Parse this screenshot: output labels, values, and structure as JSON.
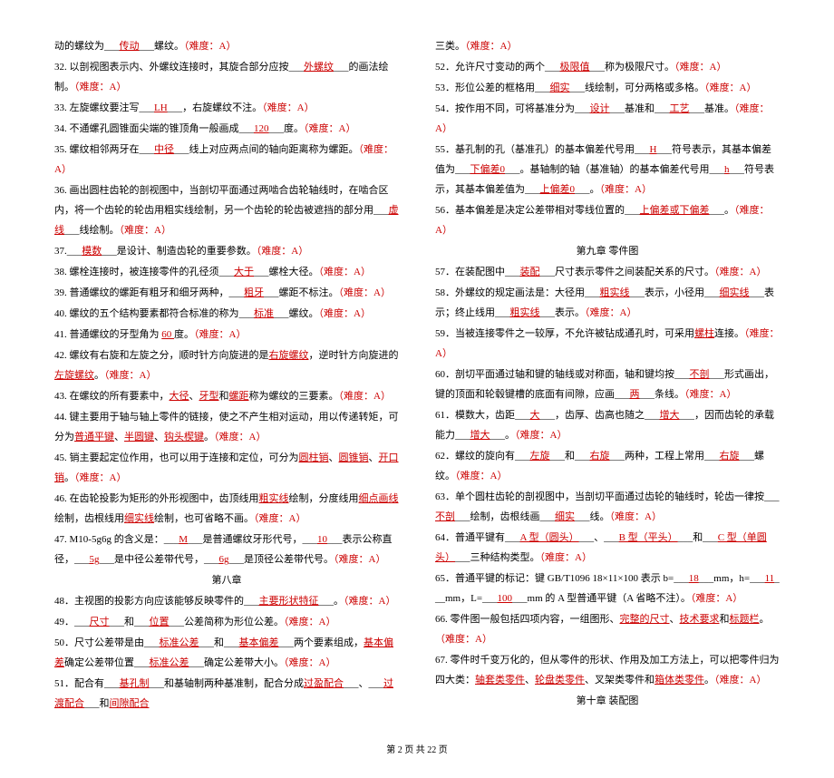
{
  "left": {
    "l31": {
      "pre": "动的螺纹为___",
      "a1": "传动",
      "post": "___螺纹。",
      "diff": "（难度：A）"
    },
    "l32": {
      "pre": "32. 以剖视图表示内、外螺纹连接时，其旋合部分应按___",
      "a1": "外螺纹",
      "post": "___的画法绘制。",
      "diff": "（难度：A）"
    },
    "l33": {
      "pre": "33. 左旋螺纹要注写___",
      "a1": "LH",
      "post": "___，右旋螺纹不注。",
      "diff": "（难度：A）"
    },
    "l34": {
      "pre": "34. 不通螺孔圆锥面尖端的锥顶角一般画成___",
      "a1": "120",
      "post": "___度。",
      "diff": "（难度：A）"
    },
    "l35": {
      "pre": "35. 螺纹相邻两牙在___",
      "a1": "中径",
      "post": "___线上对应两点间的轴向距离称为螺距。",
      "diff": "（难度：A）"
    },
    "l36": {
      "pre": "36. 画出圆柱齿轮的剖视图中，当剖切平面通过两啮合齿轮轴线时，在啮合区内，将一个齿轮的轮齿用粗实线绘制，另一个齿轮的轮齿被遮挡的部分用___",
      "a1": "虚线",
      "post": "___线绘制。",
      "diff": "（难度：A）"
    },
    "l37": {
      "pre": "37.___",
      "a1": "模数",
      "post": "___是设计、制造齿轮的重要参数。",
      "diff": "（难度：A）"
    },
    "l38": {
      "pre": "38. 螺栓连接时，被连接零件的孔径须___",
      "a1": "大于",
      "post": "___螺栓大径。",
      "diff": "（难度：A）"
    },
    "l39": {
      "pre": "39. 普通螺纹的螺距有粗牙和细牙两种，___",
      "a1": "粗牙",
      "post": "___螺距不标注。",
      "diff": "（难度：A）"
    },
    "l40": {
      "pre": "40. 螺纹的五个结构要素都符合标准的称为___",
      "a1": "标准",
      "post": "___螺纹。",
      "diff": "（难度：A）"
    },
    "l41": {
      "pre": "41. 普通螺纹的牙型角为 ",
      "a1": "60 ",
      "post": "度。",
      "diff": "（难度：A）"
    },
    "l42": {
      "pre": "42. 螺纹有右旋和左旋之分，顺时针方向旋进的是",
      "a1": "右旋螺纹",
      "mid": "，逆时针方向旋进的",
      "a2": "左旋螺纹",
      "post": "。",
      "diff": "（难度：A）"
    },
    "l43": {
      "pre": "43. 在螺纹的所有要素中，",
      "a1": "大径",
      "c1": "、",
      "a2": "牙型",
      "c2": "和",
      "a3": "螺距",
      "post": "称为螺纹的三要素。",
      "diff": "（难度：A）"
    },
    "l44": {
      "pre": "44. 键主要用于轴与轴上零件的链接，使之不产生相对运动，用以传递转矩，可分为",
      "a1": "普通平键",
      "c1": "、",
      "a2": "半圆键",
      "c2": "、",
      "a3": "钩头楔键",
      "post": "。",
      "diff": "（难度：A）"
    },
    "l45": {
      "pre": "45. 销主要起定位作用，也可以用于连接和定位，可分为",
      "a1": "圆柱销",
      "c1": "、",
      "a2": "圆锥销",
      "c2": "、",
      "a3": "开口销",
      "post": "。",
      "diff": "（难度：A）"
    },
    "l46": {
      "pre": "46. 在齿轮投影为矩形的外形视图中，齿顶线用",
      "a1": "粗实线",
      "mid1": "绘制，分度线用",
      "a2": "细点画线",
      "mid2": "绘制，齿根线用",
      "a3": "细实线",
      "post": "绘制，也可省略不画。",
      "diff": "（难度：A）"
    },
    "l47": {
      "pre": "47. M10-5g6g 的含义是：___",
      "a1": "M",
      "mid1": "___是普通螺纹牙形代号，___",
      "a2": "10",
      "mid2": "___表示公称直径，___",
      "a3": "5g",
      "post": "___是中径公差带代号，___",
      "a4": "6g",
      "post2": "___是顶径公差带代号。",
      "diff": "（难度：A）"
    },
    "s8": "第八章",
    "l48": {
      "pre": "48．主视图的投影方向应该能够反映零件的___",
      "a1": "主要形状特征",
      "post": "___。",
      "diff": "（难度：A）"
    },
    "l49": {
      "pre": "49．___",
      "a1": "尺寸",
      "mid": "___和___",
      "a2": "位置",
      "post": "___公差简称为形位公差。",
      "diff": "（难度：A）"
    },
    "l50": {
      "pre": "50．尺寸公差带是由___",
      "a1": "标准公差",
      "mid": "___和___",
      "a2": "基本偏差",
      "mid2": "___两个要素组成，",
      "a3": "基本偏差",
      "mid3": "确定公差带位置___",
      "a4": "标准公差",
      "post": "___确定公差带大小。",
      "diff": "（难度：A）"
    },
    "l51": {
      "pre": "51．配合有___",
      "a1": "基孔制",
      "mid": "___和基轴制两种基准制，配合分成",
      "a2": "过盈配合",
      "c1": "___、___",
      "a3": "过渡配合",
      "c2": "___和",
      "a4": "间隙配合"
    }
  },
  "right": {
    "l51b": {
      "pre": "三类。",
      "diff": "（难度：A）"
    },
    "l52": {
      "pre": "52．允许尺寸变动的两个___",
      "a1": "极限值",
      "post": "___称为极限尺寸。",
      "diff": "（难度：A）"
    },
    "l53": {
      "pre": "53．形位公差的框格用___",
      "a1": "细实",
      "post": "___线绘制，可分两格或多格。",
      "diff": "（难度：A）"
    },
    "l54": {
      "pre": "54．按作用不同，可将基准分为___",
      "a1": "设计",
      "mid": "___基准和___",
      "a2": "工艺",
      "post": "___基准。",
      "diff": "（难度：A）"
    },
    "l55": {
      "pre": "55．基孔制的孔（基准孔）的基本偏差代号用___",
      "a1": "H",
      "mid": "___符号表示，其基本偏差值为___",
      "a2": "下偏差0",
      "post": "___。基轴制的轴（基准轴）的基本偏差代号用___",
      "a3": "h",
      "mid2": "___符号表示，其基本偏差值为___",
      "a4": "上偏差0",
      "post2": "___。",
      "diff": "（难度：A）"
    },
    "l56": {
      "pre": "56．基本偏差是决定公差带相对零线位置的___",
      "a1": "上偏差或下偏差",
      "post": "___。",
      "diff": "（难度：A）"
    },
    "s9": "第九章 零件图",
    "l57": {
      "pre": "57．在装配图中___",
      "a1": "装配",
      "post": "___尺寸表示零件之间装配关系的尺寸。",
      "diff": "（难度：A）"
    },
    "l58": {
      "pre": "58．外螺纹的规定画法是：大径用___",
      "a1": "粗实线",
      "mid": "___表示，小径用___",
      "a2": "细实线",
      "mid2": "___表示；终止线用___",
      "a3": "粗实线",
      "post": "___表示。",
      "diff": "（难度：A）"
    },
    "l59": {
      "pre": "59．当被连接零件之一较厚，不允许被钻成通孔时，可采用",
      "a1": "螺柱",
      "post": "连接。",
      "diff": "（难度：A）"
    },
    "l60": {
      "pre": "60．剖切平面通过轴和键的轴线或对称面，轴和键均按___",
      "a1": "不剖",
      "post": "___形式画出，键的顶面和轮毂键槽的底面有间隙，应画___",
      "a2": "两",
      "post2": "___条线。",
      "diff": "（难度：A）"
    },
    "l61": {
      "pre": "61．模数大，齿距___",
      "a1": "大",
      "mid": "___，齿厚、齿高也随之___",
      "a2": "增大",
      "mid2": "___，因而齿轮的承载能力___",
      "a3": "增大",
      "post": "___。",
      "diff": "（难度：A）"
    },
    "l62": {
      "pre": "62．螺纹的旋向有___",
      "a1": "左旋",
      "mid": "___和___",
      "a2": "右旋",
      "mid2": "___两种，工程上常用___",
      "a3": "右旋",
      "post": "___螺纹。",
      "diff": "（难度：A）"
    },
    "l63": {
      "pre": "63．单个圆柱齿轮的剖视图中，当剖切平面通过齿轮的轴线时，轮齿一律按___",
      "a1": "不剖",
      "post": "___绘制，齿根线画___",
      "a2": "细实",
      "post2": "___线。",
      "diff": "（难度：A）"
    },
    "l64": {
      "pre": "64．普通平键有___",
      "a1": "A 型（圆头）",
      "mid": "___、___",
      "a2": "B 型（平头）",
      "mid2": "___和___",
      "a3": "C 型（单圆头）",
      "post": "___三种结构类型。",
      "diff": "（难度：A）"
    },
    "l65": {
      "pre": "65．普通平键的标记：键 GB/T1096 18×11×100 表示 b=___",
      "a1": "18",
      "mid": "___mm，h=___",
      "a2": "11",
      "mid2": "___mm，L=___",
      "a3": "100",
      "post": "___mm 的 A 型普通平键（A 省略不注）。",
      "diff": "（难度：A）"
    },
    "l66": {
      "pre": "66. 零件图一般包括四项内容，一组图形、",
      "a1": "完整的尺寸",
      "c1": "、",
      "a2": "技术要求",
      "c2": "和",
      "a3": "标题栏",
      "post": "。",
      "diff": "（难度：A）"
    },
    "l67": {
      "pre": "67. 零件时千变万化的，但从零件的形状、作用及加工方法上，可以把零件归为四大类：",
      "a1": "轴套类零件",
      "c1": "、",
      "a2": "轮盘类零件",
      "c2": "、叉架类零件和",
      "a3": "箱体类零件",
      "post": "。",
      "diff": "（难度：A）"
    },
    "s10": "第十章 装配图"
  },
  "footer": "第 2 页 共 22 页"
}
